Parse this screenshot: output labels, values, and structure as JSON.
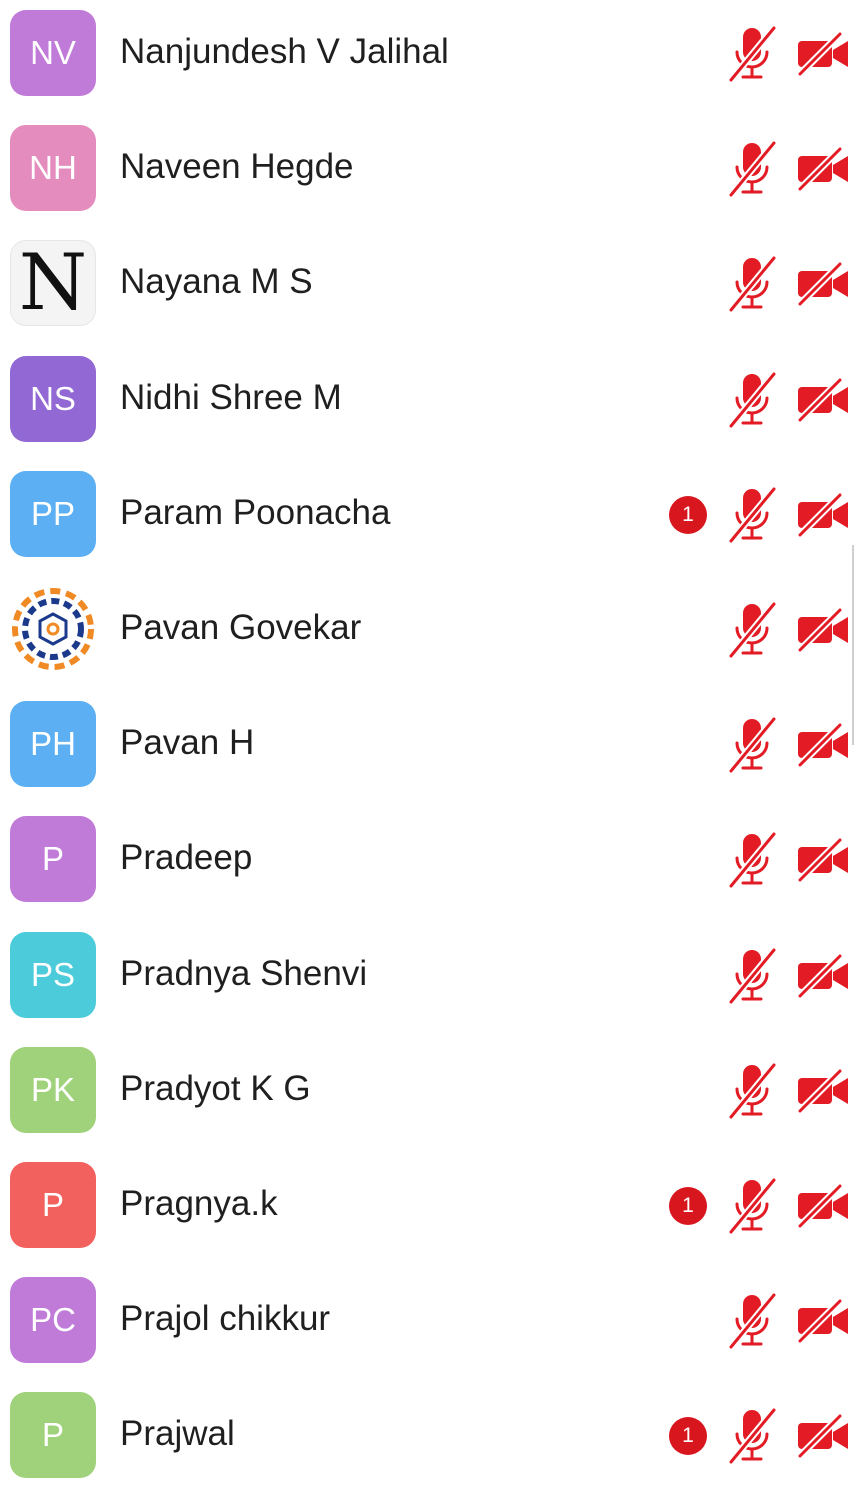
{
  "colors": {
    "muted_icon": "#e21b24",
    "badge": "#d8161d"
  },
  "participants": [
    {
      "initials": "NV",
      "name": "Nanjundesh V Jalihal",
      "avatar_color": "#c07ad8",
      "badge": null
    },
    {
      "initials": "NH",
      "name": "Naveen Hegde",
      "avatar_color": "#e48cbd",
      "badge": null
    },
    {
      "initials": "N",
      "name": "Nayana M S",
      "avatar_type": "letter-image",
      "badge": null
    },
    {
      "initials": "NS",
      "name": "Nidhi Shree M",
      "avatar_color": "#9268d4",
      "badge": null
    },
    {
      "initials": "PP",
      "name": "Param Poonacha",
      "avatar_color": "#5baff2",
      "badge": "1"
    },
    {
      "initials": "",
      "name": "Pavan Govekar",
      "avatar_type": "logo-image",
      "badge": null
    },
    {
      "initials": "PH",
      "name": "Pavan H",
      "avatar_color": "#5baff2",
      "badge": null
    },
    {
      "initials": "P",
      "name": "Pradeep",
      "avatar_color": "#c07ad8",
      "badge": null
    },
    {
      "initials": "PS",
      "name": "Pradnya Shenvi",
      "avatar_color": "#4ccbda",
      "badge": null
    },
    {
      "initials": "PK",
      "name": "Pradyot K G",
      "avatar_color": "#9fd27a",
      "badge": null
    },
    {
      "initials": "P",
      "name": "Pragnya.k",
      "avatar_color": "#f2615e",
      "badge": "1"
    },
    {
      "initials": "PC",
      "name": "Prajol chikkur",
      "avatar_color": "#c07ad8",
      "badge": null
    },
    {
      "initials": "P",
      "name": "Prajwal",
      "avatar_color": "#9fd27a",
      "badge": "1"
    }
  ],
  "icons": {
    "mic": "mic-muted-icon",
    "camera": "camera-off-icon"
  }
}
